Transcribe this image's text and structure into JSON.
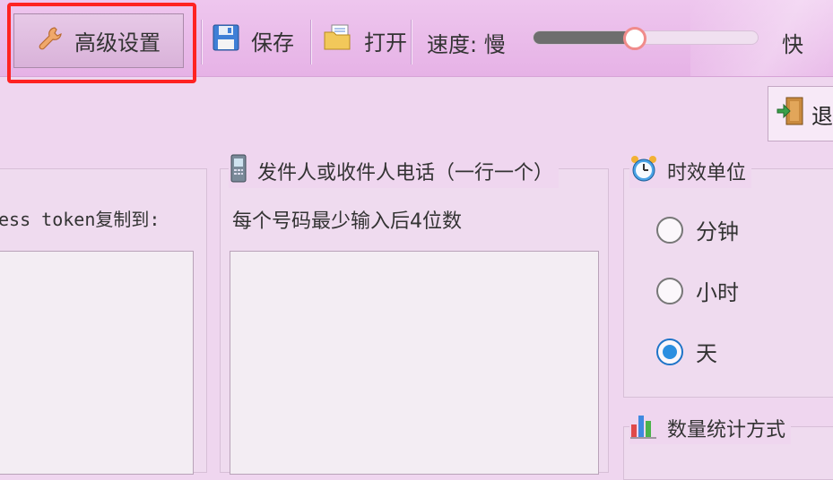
{
  "toolbar": {
    "advanced_settings": "高级设置",
    "save": "保存",
    "open": "打开",
    "speed_label": "速度:",
    "speed_slow": "慢",
    "speed_fast": "快",
    "speed_level": 0.45,
    "exit": "退"
  },
  "left_panel": {
    "label": "ess token复制到:"
  },
  "phone_panel": {
    "title": "发件人或收件人电话（一行一个）",
    "hint": "每个号码最少输入后4位数"
  },
  "time_unit_panel": {
    "title": "时效单位",
    "options": [
      "分钟",
      "小时",
      "天"
    ],
    "selected_index": 2
  },
  "stats_panel": {
    "title": "数量统计方式"
  },
  "colors": {
    "highlight": "#ff2222",
    "radio_checked": "#2b8fe0",
    "background": "#efd6ef"
  }
}
